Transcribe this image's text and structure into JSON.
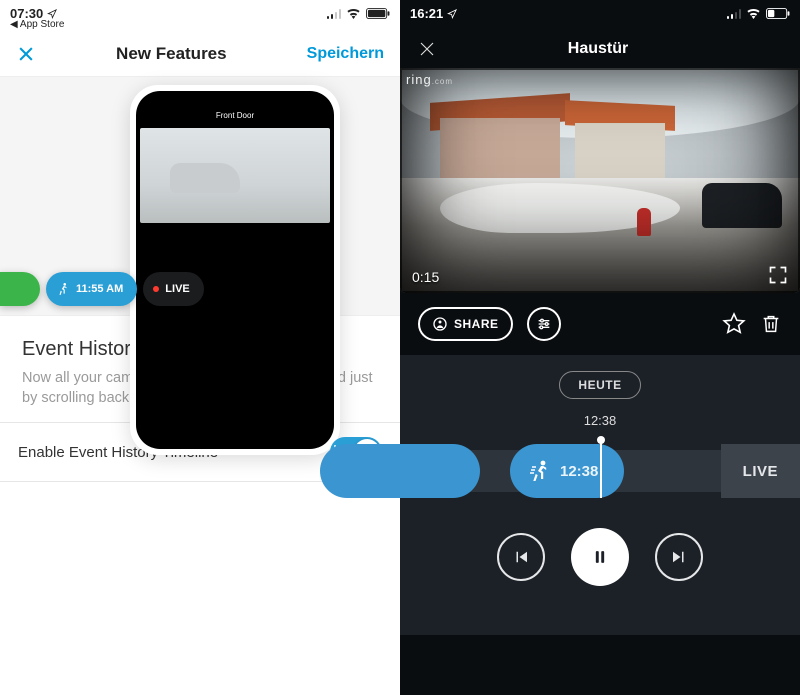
{
  "left": {
    "status": {
      "time": "07:30",
      "back_app": "App Store"
    },
    "nav": {
      "title": "New Features",
      "save": "Speichern"
    },
    "promo": {
      "phone_label": "Front Door",
      "chip_time": "11:55 AM",
      "chip_live": "LIVE"
    },
    "section": {
      "title": "Event History Timeline",
      "desc": "Now all your camera events can be quickly viewed just by scrolling back in time."
    },
    "toggle": {
      "label": "Enable Event History Timeline",
      "on": true
    }
  },
  "right": {
    "status": {
      "time": "16:21"
    },
    "nav": {
      "title": "Haustür"
    },
    "video": {
      "watermark": "ring",
      "watermark_suffix": ".com",
      "elapsed": "0:15"
    },
    "actions": {
      "share": "SHARE"
    },
    "timeline": {
      "date_label": "HEUTE",
      "timestamp": "12:38",
      "event_time": "12:38",
      "live": "LIVE"
    }
  }
}
